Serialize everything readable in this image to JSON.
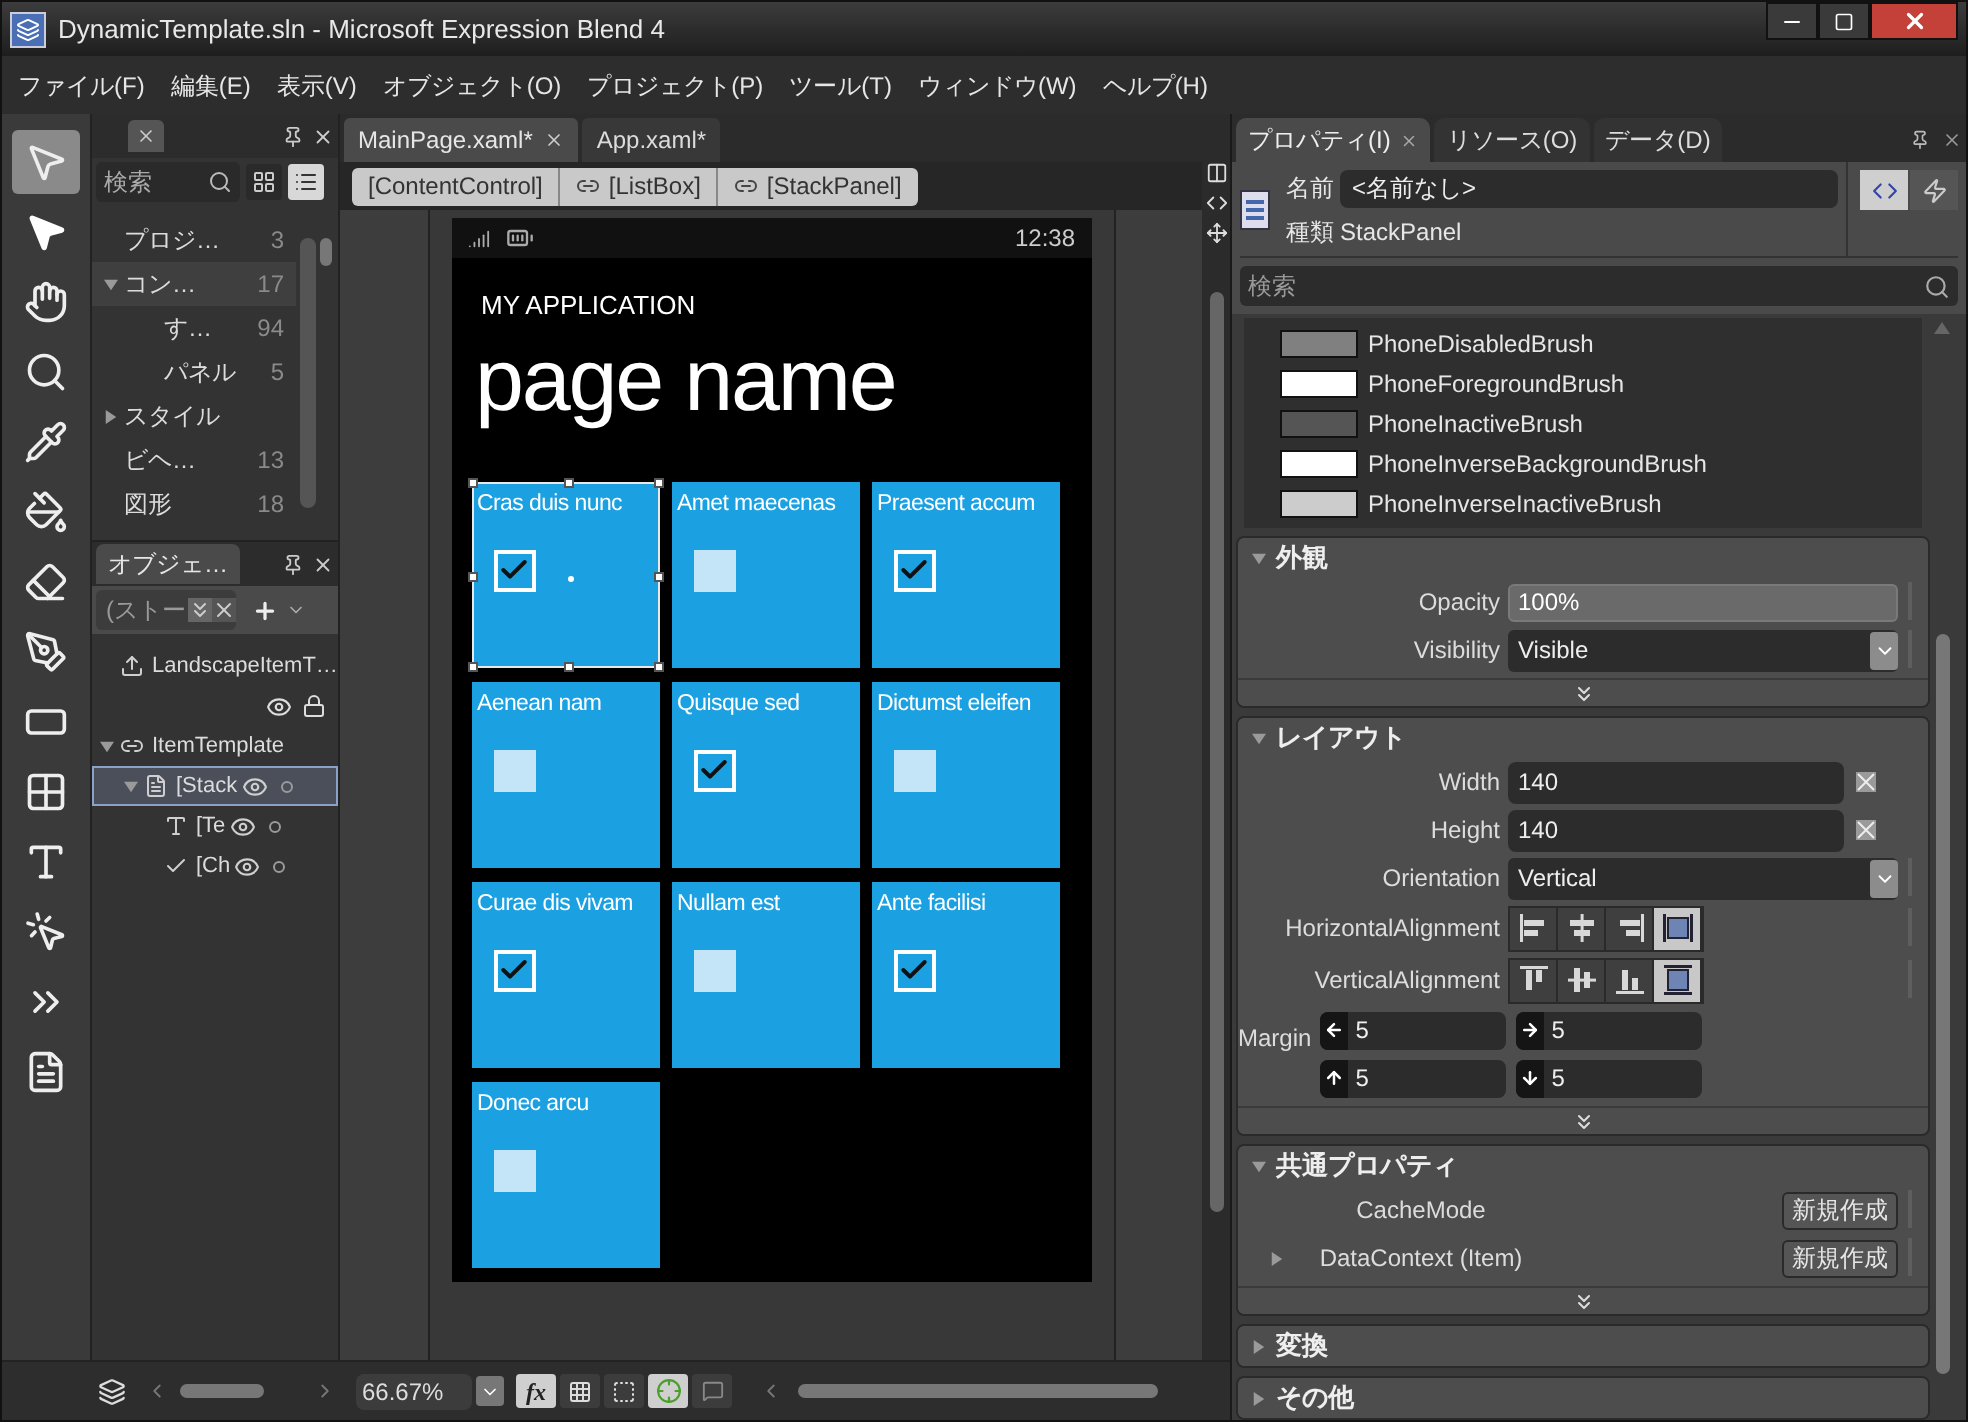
{
  "window": {
    "title": "DynamicTemplate.sln - Microsoft Expression Blend 4"
  },
  "menu": [
    "ファイル(F)",
    "編集(E)",
    "表示(V)",
    "オブジェクト(O)",
    "プロジェクト(P)",
    "ツール(T)",
    "ウィンドウ(W)",
    "ヘルプ(H)"
  ],
  "tools": [
    {
      "kind": "select",
      "selected": true
    },
    {
      "kind": "direct",
      "selected": false
    },
    {
      "kind": "pan",
      "selected": false
    },
    {
      "kind": "zoom",
      "selected": false
    },
    {
      "kind": "eyedropper",
      "selected": false
    },
    {
      "kind": "paint",
      "selected": false
    },
    {
      "kind": "eraser",
      "selected": false
    },
    {
      "kind": "pen",
      "selected": false
    },
    {
      "kind": "rectangle",
      "selected": false
    },
    {
      "kind": "grid",
      "selected": false
    },
    {
      "kind": "text",
      "selected": false
    },
    {
      "kind": "control",
      "selected": false
    },
    {
      "kind": "more",
      "selected": false
    },
    {
      "kind": "assets",
      "selected": false
    }
  ],
  "assets_panel": {
    "search": {
      "placeholder": "検索"
    },
    "view_buttons": [
      {
        "kind": "grid",
        "selected": false
      },
      {
        "kind": "list",
        "selected": true
      }
    ],
    "items": [
      {
        "label": "プロジ…",
        "count": "3",
        "selected": false
      },
      {
        "label": "コン…",
        "count": "17",
        "selected": true,
        "expanded": true,
        "children": [
          {
            "label": "す…",
            "count": "94",
            "selected": false
          },
          {
            "label": "パネル",
            "count": "5",
            "selected": false
          }
        ]
      },
      {
        "label": "スタイル",
        "selected": false,
        "expanded": false
      },
      {
        "label": "ビヘ…",
        "count": "13",
        "selected": false
      },
      {
        "label": "図形",
        "count": "18",
        "selected": false
      }
    ]
  },
  "objects_panel": {
    "title": "オブジェ…",
    "scope": "(ストー",
    "tree": [
      {
        "label": "LandscapeItemT…",
        "kind": "state",
        "selected": false
      },
      {
        "label": "ItemTemplate",
        "kind": "template",
        "selected": false,
        "expanded": true,
        "children": [
          {
            "label": "[Stack",
            "kind": "panel",
            "selected": true,
            "expanded": true,
            "children": [
              {
                "label": "[Te",
                "kind": "textblock",
                "selected": false
              },
              {
                "label": "[Ch",
                "kind": "checkbox",
                "selected": false
              }
            ]
          }
        ]
      }
    ]
  },
  "document_tabs": [
    {
      "label": "MainPage.xaml*",
      "selected": true
    },
    {
      "label": "App.xaml*",
      "selected": false
    }
  ],
  "breadcrumb": [
    {
      "label": "[ContentControl]",
      "kind": "plain"
    },
    {
      "label": "[ListBox]",
      "kind": "linked"
    },
    {
      "label": "[StackPanel]",
      "kind": "linked"
    }
  ],
  "phone": {
    "time": "12:38",
    "app_title": "MY APPLICATION",
    "page_title": "page name",
    "tiles": [
      {
        "label": "Cras duis nunc",
        "checked": true,
        "selected": true
      },
      {
        "label": "Amet maecenas",
        "checked": false,
        "selected": false
      },
      {
        "label": "Praesent accum",
        "checked": true,
        "selected": false
      },
      {
        "label": "Aenean nam",
        "checked": false,
        "selected": false
      },
      {
        "label": "Quisque sed",
        "checked": true,
        "selected": false
      },
      {
        "label": "Dictumst eleifen",
        "checked": false,
        "selected": false
      },
      {
        "label": "Curae dis vivam",
        "checked": true,
        "selected": false
      },
      {
        "label": "Nullam est",
        "checked": false,
        "selected": false
      },
      {
        "label": "Ante facilisi",
        "checked": true,
        "selected": false
      },
      {
        "label": "Donec arcu",
        "checked": false,
        "selected": false
      }
    ]
  },
  "status_bar": {
    "zoom": "66.67%",
    "toggles": [
      {
        "kind": "fx",
        "label": "fx",
        "selected": true
      },
      {
        "kind": "grid",
        "selected": false
      },
      {
        "kind": "snap",
        "selected": false
      },
      {
        "kind": "guides",
        "selected": true
      },
      {
        "kind": "note",
        "selected": false
      }
    ]
  },
  "properties_panel": {
    "tabs": [
      {
        "label": "プロパティ(I)",
        "selected": true
      },
      {
        "label": "リソース(O)",
        "selected": false
      },
      {
        "label": "データ(D)",
        "selected": false
      }
    ],
    "name_label": "名前",
    "name_value": "<名前なし>",
    "type_label": "種類",
    "type_value": "StackPanel",
    "mode_buttons": [
      {
        "kind": "properties",
        "selected": true
      },
      {
        "kind": "events",
        "selected": false
      }
    ],
    "search": {
      "placeholder": "検索"
    },
    "brushes": [
      {
        "name": "PhoneDisabledBrush",
        "color": "#808080"
      },
      {
        "name": "PhoneForegroundBrush",
        "color": "#ffffff"
      },
      {
        "name": "PhoneInactiveBrush",
        "color": "#555555"
      },
      {
        "name": "PhoneInverseBackgroundBrush",
        "color": "#ffffff"
      },
      {
        "name": "PhoneInverseInactiveBrush",
        "color": "#cccccc"
      }
    ],
    "sections": [
      {
        "title": "外観",
        "expanded": true,
        "rows": [
          {
            "kind": "text",
            "label": "Opacity",
            "value": "100%"
          },
          {
            "kind": "dropdown",
            "label": "Visibility",
            "value": "Visible"
          }
        ]
      },
      {
        "title": "レイアウト",
        "expanded": true,
        "rows": [
          {
            "kind": "number",
            "label": "Width",
            "value": "140"
          },
          {
            "kind": "number",
            "label": "Height",
            "value": "140"
          },
          {
            "kind": "dropdown",
            "label": "Orientation",
            "value": "Vertical"
          },
          {
            "kind": "align",
            "label": "HorizontalAlignment",
            "options": [
              {
                "kind": "left",
                "selected": false
              },
              {
                "kind": "center",
                "selected": false
              },
              {
                "kind": "right",
                "selected": false
              },
              {
                "kind": "stretch",
                "selected": true
              }
            ]
          },
          {
            "kind": "align",
            "label": "VerticalAlignment",
            "options": [
              {
                "kind": "top",
                "selected": false
              },
              {
                "kind": "middle",
                "selected": false
              },
              {
                "kind": "bottom",
                "selected": false
              },
              {
                "kind": "fill",
                "selected": true
              }
            ]
          },
          {
            "kind": "margin",
            "label": "Margin",
            "values": [
              "5",
              "5",
              "5",
              "5"
            ]
          }
        ]
      },
      {
        "title": "共通プロパティ",
        "expanded": true,
        "rows": [
          {
            "kind": "button",
            "label": "CacheMode",
            "button": "新規作成",
            "expandable": false
          },
          {
            "kind": "button",
            "label": "DataContext (Item)",
            "button": "新規作成",
            "expandable": true
          }
        ]
      },
      {
        "title": "変換",
        "expanded": false
      },
      {
        "title": "その他",
        "expanded": false
      }
    ]
  }
}
